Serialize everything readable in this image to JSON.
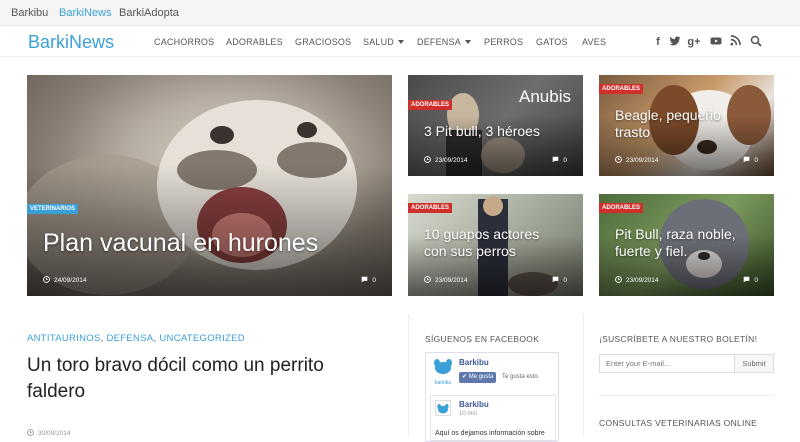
{
  "top_links": [
    "Barkibu",
    "BarkiNews",
    "BarkiAdopta"
  ],
  "nav": {
    "logo": "BarkiNews",
    "menu": [
      "CACHORROS",
      "ADORABLES",
      "GRACIOSOS",
      "SALUD",
      "DEFENSA",
      "PERROS",
      "GATOS",
      "AVES"
    ],
    "social_icons": [
      "facebook-icon",
      "twitter-icon",
      "google-plus-icon",
      "youtube-icon",
      "rss-icon",
      "search-icon"
    ]
  },
  "featured": [
    {
      "tag": "VETERINARIOS",
      "title": "Plan vacunal en hurones",
      "date": "24/09/2014",
      "comments": "0"
    },
    {
      "tag": "ADORABLES",
      "title": "3 Pit bull, 3 héroes",
      "overlay": "Anubis",
      "date": "23/09/2014",
      "comments": "0"
    },
    {
      "tag": "ADORABLES",
      "title": "Beagle, pequeño trasto",
      "date": "23/09/2014",
      "comments": "0"
    },
    {
      "tag": "ADORABLES",
      "title": "10 guapos actores con sus perros",
      "date": "23/09/2014",
      "comments": "0"
    },
    {
      "tag": "ADORABLES",
      "title": "Pit Bull, raza noble, fuerte y fiel.",
      "date": "23/09/2014",
      "comments": "0"
    }
  ],
  "post": {
    "categories": [
      "ANTITAURINOS",
      "DEFENSA",
      "UNCATEGORIZED"
    ],
    "title": "Un toro bravo dócil como un perrito faldero",
    "date": "30/09/2014"
  },
  "facebook_widget": {
    "title": "SÍGUENOS EN FACEBOOK",
    "page_name": "Barkibu",
    "logo_text": "barkibu",
    "like_button": "Me gusta",
    "like_text": "Te gusta esto.",
    "post_author": "Barkibu",
    "post_time": "10 min",
    "post_text": "Aquí os dejamos información sobre"
  },
  "newsletter": {
    "title": "¡SUSCRÍBETE A NUESTRO BOLETÍN!",
    "placeholder": "Enter your E-mail...",
    "submit": "Submit"
  },
  "consultas_title": "CONSULTAS VETERINARIAS ONLINE",
  "colors": {
    "accent": "#3aa0d8",
    "tag_red": "#d0302b"
  }
}
